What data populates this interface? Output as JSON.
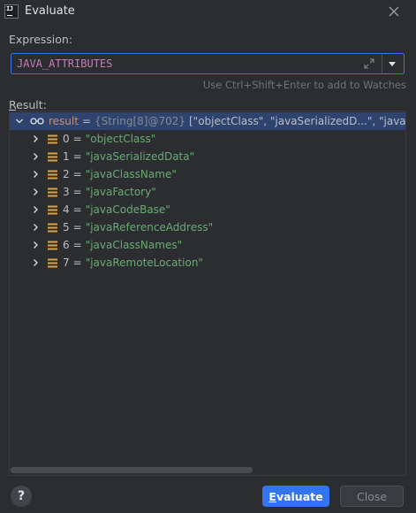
{
  "window": {
    "title": "Evaluate",
    "app_icon_label": "IJ"
  },
  "expression": {
    "label": "Expression:",
    "value": "JAVA_ATTRIBUTES",
    "hint": "Use Ctrl+Shift+Enter to add to Watches"
  },
  "result": {
    "label_mnemonic": "R",
    "label_rest": "esult:",
    "root": {
      "name": "result",
      "type": "{String[8]@702}",
      "value": "[\"objectClass\", \"javaSerializedD...\", \"javaClassN"
    },
    "items": [
      {
        "index": "0",
        "value": "\"objectClass\""
      },
      {
        "index": "1",
        "value": "\"javaSerializedData\""
      },
      {
        "index": "2",
        "value": "\"javaClassName\""
      },
      {
        "index": "3",
        "value": "\"javaFactory\""
      },
      {
        "index": "4",
        "value": "\"javaCodeBase\""
      },
      {
        "index": "5",
        "value": "\"javaReferenceAddress\""
      },
      {
        "index": "6",
        "value": "\"javaClassNames\""
      },
      {
        "index": "7",
        "value": "\"javaRemoteLocation\""
      }
    ]
  },
  "buttons": {
    "help": "?",
    "evaluate_mnemonic": "E",
    "evaluate_rest": "valuate",
    "close": "Close"
  },
  "icons": {
    "app": "intellij-icon",
    "close": "close-icon",
    "expand": "expand-icon",
    "dropdown": "chevron-down-icon",
    "watch": "glasses-icon",
    "field": "array-element-icon"
  },
  "colors": {
    "accent": "#3574f0",
    "string_value": "#6aab73",
    "result_name": "#cf8e6d",
    "expression_text": "#c77dbb",
    "selection": "#2e436e"
  }
}
